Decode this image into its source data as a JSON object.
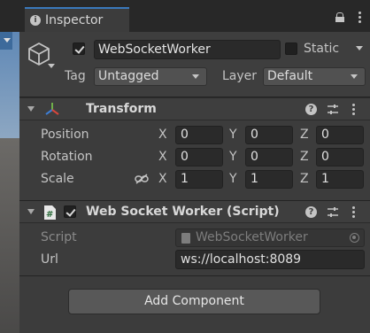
{
  "inspector": {
    "tab_label": "Inspector",
    "tab_icon": "info-icon"
  },
  "gameobject": {
    "active": true,
    "name": "WebSocketWorker",
    "static_label": "Static",
    "static": false,
    "tag_label": "Tag",
    "tag_value": "Untagged",
    "layer_label": "Layer",
    "layer_value": "Default"
  },
  "transform": {
    "title": "Transform",
    "position_label": "Position",
    "rotation_label": "Rotation",
    "scale_label": "Scale",
    "axes": {
      "x": "X",
      "y": "Y",
      "z": "Z"
    },
    "position": {
      "x": "0",
      "y": "0",
      "z": "0"
    },
    "rotation": {
      "x": "0",
      "y": "0",
      "z": "0"
    },
    "scale": {
      "x": "1",
      "y": "1",
      "z": "1"
    }
  },
  "script_component": {
    "title": "Web Socket Worker (Script)",
    "enabled": true,
    "script_label": "Script",
    "script_value": "WebSocketWorker",
    "url_label": "Url",
    "url_value": "ws://localhost:8089"
  },
  "add_component_label": "Add Component",
  "colors": {
    "panel_bg": "#3c3c3c",
    "tab_accent": "#3a79bb",
    "field_bg": "#2a2a2a",
    "button_bg": "#585858"
  }
}
